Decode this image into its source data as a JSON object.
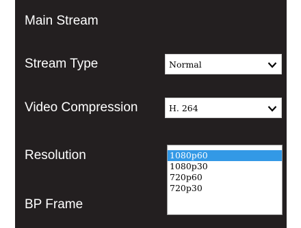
{
  "section_title": "Main Stream",
  "fields": {
    "stream_type": {
      "label": "Stream Type",
      "value": "Normal",
      "icon": "chevron-down-icon"
    },
    "video_compression": {
      "label": "Video Compression",
      "value": "H. 264",
      "icon": "chevron-down-icon"
    },
    "resolution": {
      "label": "Resolution",
      "options": [
        "1080p60",
        "1080p30",
        "720p60",
        "720p30"
      ],
      "selected_index": 0
    },
    "bp_frame": {
      "label": "BP Frame"
    }
  },
  "colors": {
    "panel_background": "#231f20",
    "selection_highlight": "#3399e6",
    "text_light": "#ffffff"
  }
}
